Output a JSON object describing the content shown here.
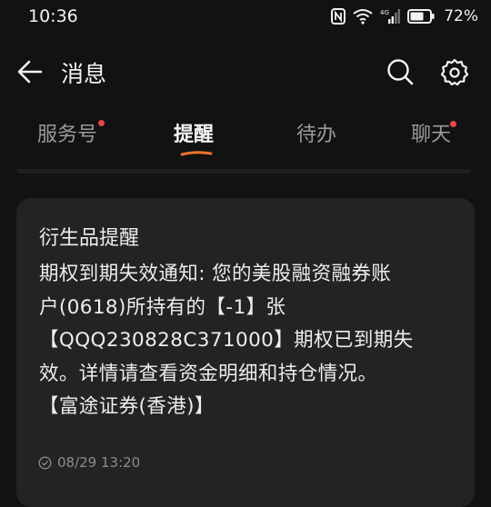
{
  "status_bar": {
    "time": "10:36",
    "network_label": "4G",
    "battery": "72%"
  },
  "header": {
    "title": "消息",
    "icons": {
      "back": "arrow-left-icon",
      "search": "search-icon",
      "settings": "gear-icon"
    }
  },
  "tabs": [
    {
      "label": "服务号",
      "unread_dot": true
    },
    {
      "label": "提醒",
      "active": true
    },
    {
      "label": "待办"
    },
    {
      "label": "聊天",
      "unread_dot": true
    }
  ],
  "colors": {
    "accent": "#f0712c",
    "unread_dot": "#e5474b",
    "card_bg": "#232323",
    "background": "#121212"
  },
  "card": {
    "title": "衍生品提醒",
    "body_lines": [
      "期权到期失效通知: 您的美股融资融券账",
      "户(0618)所持有的【-1】张",
      "【QQQ230828C371000】期权已到期失",
      "效。详情请查看资金明细和持仓情况。",
      "【富途证券(香港)】"
    ],
    "timestamp": "08/29 13:20",
    "status_icon": "check-circle-icon"
  }
}
